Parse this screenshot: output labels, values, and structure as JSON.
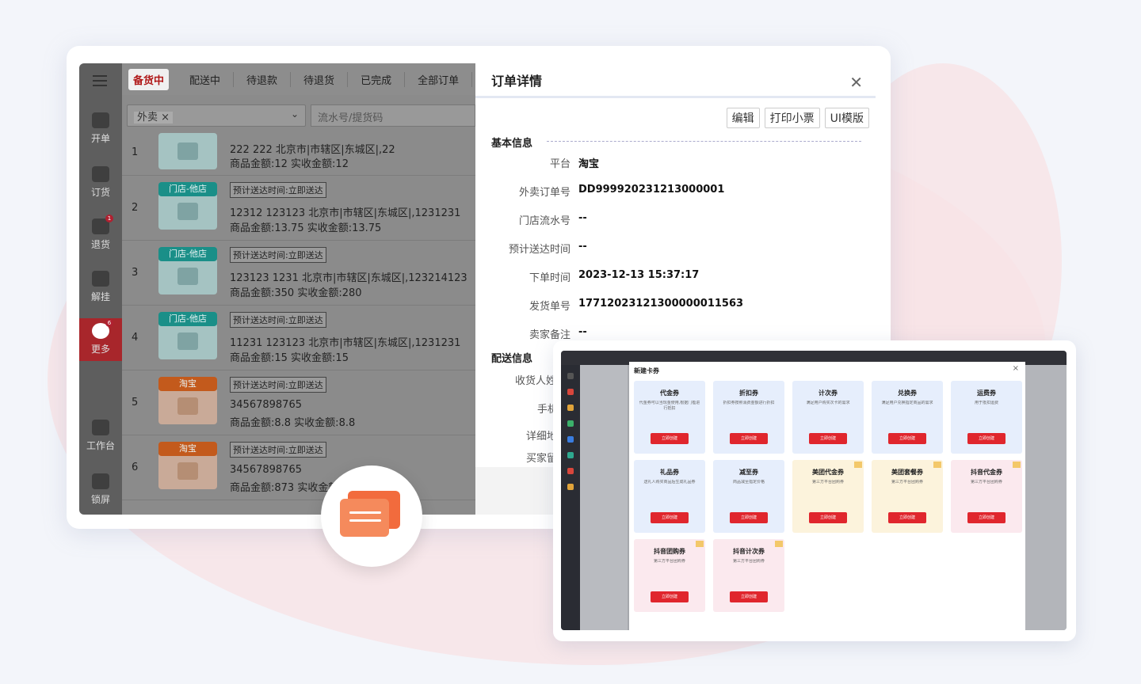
{
  "sidebar": {
    "items": [
      {
        "label": "开单"
      },
      {
        "label": "订货"
      },
      {
        "label": "退货",
        "badge": "1"
      },
      {
        "label": "解挂"
      },
      {
        "label": "更多",
        "badge": "6"
      },
      {
        "label": "工作台"
      },
      {
        "label": "锁屏"
      }
    ]
  },
  "tabs": [
    "备货中",
    "配送中",
    "待退款",
    "待退货",
    "已完成",
    "全部订单"
  ],
  "filters": {
    "channel_chip": "外卖",
    "search_placeholder": "流水号/提货码"
  },
  "orders": [
    {
      "index": "1",
      "tag": "",
      "eta": "",
      "line1": "222  222  北京市|市辖区|东城区|,22",
      "line2": "商品金额:12  实收金额:12"
    },
    {
      "index": "2",
      "tag": "门店-他店",
      "eta": "预计送达时间:立即送达",
      "line1": "12312  123123  北京市|市辖区|东城区|,1231231",
      "line2": "商品金额:13.75  实收金额:13.75"
    },
    {
      "index": "3",
      "tag": "门店-他店",
      "eta": "预计送达时间:立即送达",
      "line1": "123123  1231  北京市|市辖区|东城区|,123214123",
      "line2": "商品金额:350  实收金额:280"
    },
    {
      "index": "4",
      "tag": "门店-他店",
      "eta": "预计送达时间:立即送达",
      "line1": "11231  123123  北京市|市辖区|东城区|,1231231",
      "line2": "商品金额:15  实收金额:15"
    },
    {
      "index": "5",
      "tag": "淘宝",
      "eta": "预计送达时间:立即送达",
      "line1": "34567898765",
      "line2": "商品金额:8.8  实收金额:8.8"
    },
    {
      "index": "6",
      "tag": "淘宝",
      "eta": "预计送达时间:立即送达",
      "line1": "34567898765",
      "line2": "商品金额:873  实收金额:873"
    }
  ],
  "detail": {
    "title": "订单详情",
    "actions": [
      "编辑",
      "打印小票",
      "UI模版"
    ],
    "basic_title": "基本信息",
    "fields": [
      {
        "k": "平台",
        "v": "淘宝"
      },
      {
        "k": "外卖订单号",
        "v": "DD999920231213000001"
      },
      {
        "k": "门店流水号",
        "v": "--"
      },
      {
        "k": "预计送达时间",
        "v": "--"
      },
      {
        "k": "下单时间",
        "v": "2023-12-13 15:37:17"
      },
      {
        "k": "发货单号",
        "v": "17712023121300000011563"
      },
      {
        "k": "卖家备注",
        "v": "--"
      }
    ],
    "delivery_title": "配送信息",
    "delivery_fields": [
      "收货人姓",
      "手机",
      "详细地",
      "买家留"
    ]
  },
  "coupon_modal": {
    "title": "新建卡券",
    "coupons": [
      {
        "name": "代金券",
        "color": "blue",
        "desc": "代金券可以当现金使用,根据门槛进行抵扣",
        "btn": "立即创建"
      },
      {
        "name": "折扣券",
        "color": "blue",
        "desc": "折扣券按照消费金额进行折扣",
        "btn": "立即创建"
      },
      {
        "name": "计次券",
        "color": "blue",
        "desc": "满足用户购买次卡的需求",
        "btn": "立即创建"
      },
      {
        "name": "兑换券",
        "color": "blue",
        "desc": "满足用户兑换指定商品的需求",
        "btn": "立即创建"
      },
      {
        "name": "运费券",
        "color": "blue",
        "desc": "用于抵扣运费",
        "btn": "立即创建"
      },
      {
        "name": "礼品券",
        "color": "blue",
        "desc": "送礼人购买商品后生成礼品券",
        "btn": "立即创建"
      },
      {
        "name": "减至券",
        "color": "blue",
        "desc": "商品减至指定价格",
        "btn": "立即创建"
      },
      {
        "name": "美团代金券",
        "color": "yellow",
        "desc": "第三方平台团购券",
        "btn": "立即创建"
      },
      {
        "name": "美团套餐券",
        "color": "yellow",
        "desc": "第三方平台团购券",
        "btn": "立即创建"
      },
      {
        "name": "抖音代金券",
        "color": "pink",
        "desc": "第三方平台团购券",
        "btn": "立即创建"
      },
      {
        "name": "抖音团购券",
        "color": "pink",
        "desc": "第三方平台团购券",
        "btn": "立即创建"
      },
      {
        "name": "抖音计次券",
        "color": "pink",
        "desc": "第三方平台团购券",
        "btn": "立即创建"
      }
    ]
  }
}
